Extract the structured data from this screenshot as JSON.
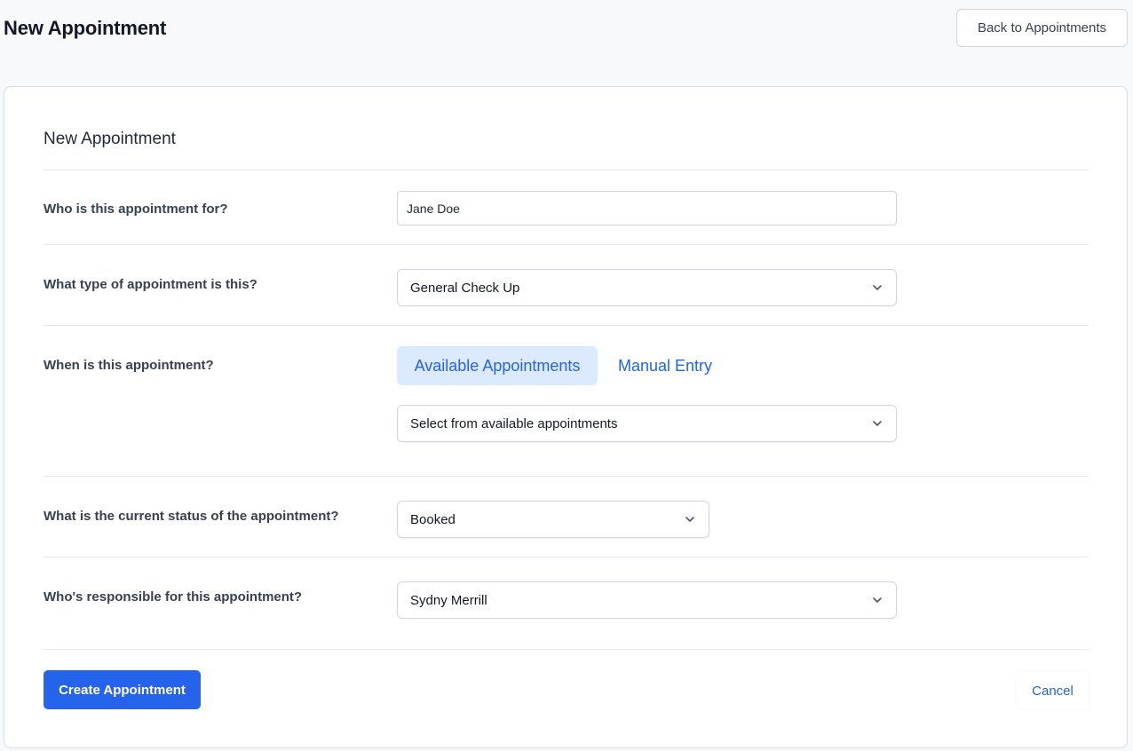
{
  "header": {
    "title": "New Appointment",
    "back_label": "Back to Appointments"
  },
  "form": {
    "title": "New Appointment",
    "patient": {
      "label": "Who is this appointment for?",
      "value": "Jane Doe"
    },
    "type": {
      "label": "What type of appointment is this?",
      "value": "General Check Up"
    },
    "when": {
      "label": "When is this appointment?",
      "tabs": [
        {
          "label": "Available Appointments",
          "active": true
        },
        {
          "label": "Manual Entry",
          "active": false
        }
      ],
      "slot_value": "Select from available appointments"
    },
    "status": {
      "label": "What is the current status of the appointment?",
      "value": "Booked"
    },
    "responsible": {
      "label": "Who's responsible for this appointment?",
      "value": "Sydny Merrill"
    },
    "actions": {
      "create_label": "Create Appointment",
      "cancel_label": "Cancel"
    }
  },
  "icons": {
    "select_chevron": "chevron-down-icon"
  },
  "colors": {
    "accent": "#2563eb",
    "active_tab_bg": "#dbeafe",
    "page_bg": "#f8f9fb",
    "border": "#d1d5db"
  }
}
